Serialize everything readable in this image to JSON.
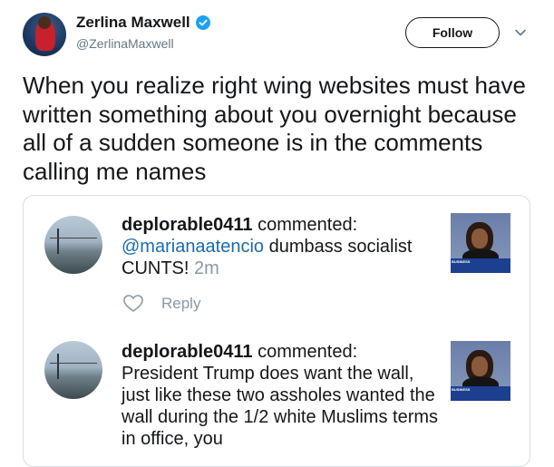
{
  "author": {
    "name": "Zerlina Maxwell",
    "handle": "@ZerlinaMaxwell",
    "verified": true,
    "avatar_icon": "profile-photo"
  },
  "actions": {
    "follow_label": "Follow",
    "menu_icon": "chevron-down-icon"
  },
  "tweet": {
    "text": "When you realize right wing websites must have written something about you overnight because all of a sudden someone is in the comments calling me names"
  },
  "comments": [
    {
      "user": "deplorable0411",
      "action": " commented:",
      "mention": "@marianaatencio",
      "body": " dumbass socialist CUNTS!",
      "time": " 2m",
      "reply_label": "Reply",
      "thumb_caption": "BUSINESS"
    },
    {
      "user": "deplorable0411",
      "action": " commented:",
      "body": " President Trump does want the wall, just like these two assholes wanted the wall during the 1/2 white Muslims terms in office, you",
      "thumb_caption": "BUSINESS"
    }
  ],
  "colors": {
    "link": "#1b6bb0",
    "verified": "#1da1f2",
    "muted": "#8899a6"
  }
}
